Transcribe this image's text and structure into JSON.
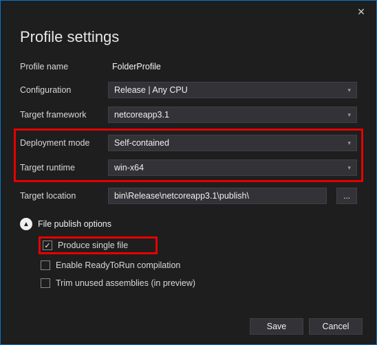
{
  "title": "Profile settings",
  "close_glyph": "✕",
  "labels": {
    "profile_name": "Profile name",
    "configuration": "Configuration",
    "target_framework": "Target framework",
    "deployment_mode": "Deployment mode",
    "target_runtime": "Target runtime",
    "target_location": "Target location"
  },
  "values": {
    "profile_name": "FolderProfile",
    "configuration": "Release | Any CPU",
    "target_framework": "netcoreapp3.1",
    "deployment_mode": "Self-contained",
    "target_runtime": "win-x64",
    "target_location": "bin\\Release\\netcoreapp3.1\\publish\\"
  },
  "browse_label": "...",
  "section": {
    "header": "File publish options",
    "chevron_glyph": "▲",
    "options": {
      "single_file": {
        "label": "Produce single file",
        "checked": true
      },
      "ready_to_run": {
        "label": "Enable ReadyToRun compilation",
        "checked": false
      },
      "trim": {
        "label": "Trim unused assemblies (in preview)",
        "checked": false
      }
    }
  },
  "buttons": {
    "save": "Save",
    "cancel": "Cancel"
  },
  "dropdown_glyph": "▾"
}
